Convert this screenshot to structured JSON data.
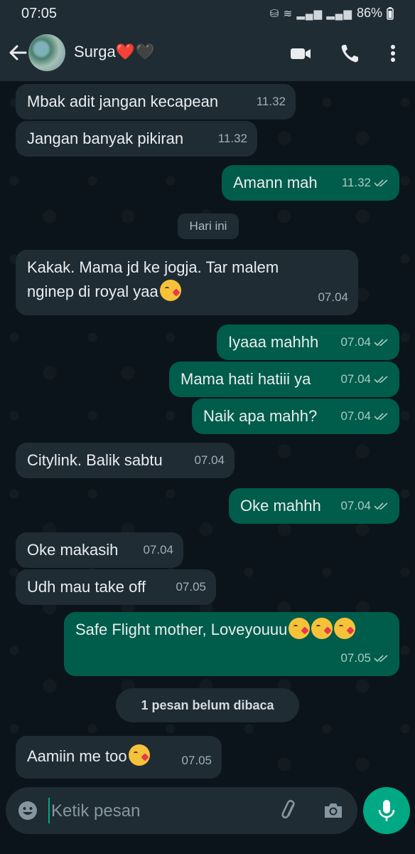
{
  "status_bar": {
    "time": "07:05",
    "battery": "86%"
  },
  "header": {
    "contact_name": "Surga❤️🖤"
  },
  "date_chip": "Hari ini",
  "unread_chip": "1 pesan belum dibaca",
  "messages": [
    {
      "dir": "in",
      "text": "Mbak adit jangan kecapean",
      "time": "11.32"
    },
    {
      "dir": "in",
      "text": "Jangan banyak pikiran",
      "time": "11.32"
    },
    {
      "dir": "out",
      "text": "Amann mah",
      "time": "11.32"
    },
    {
      "dir": "in",
      "text": "Kakak. Mama jd ke jogja. Tar malem",
      "text2": "nginep di royal yaa",
      "time": "07.04"
    },
    {
      "dir": "out",
      "text": "Iyaaa mahhh",
      "time": "07.04"
    },
    {
      "dir": "out",
      "text": "Mama hati hatiii ya",
      "time": "07.04"
    },
    {
      "dir": "out",
      "text": "Naik apa mahh?",
      "time": "07.04"
    },
    {
      "dir": "in",
      "text": "Citylink. Balik sabtu",
      "time": "07.04"
    },
    {
      "dir": "out",
      "text": "Oke mahhh",
      "time": "07.04"
    },
    {
      "dir": "in",
      "text": "Oke makasih",
      "time": "07.04"
    },
    {
      "dir": "in",
      "text": "Udh mau take off",
      "time": "07.05"
    },
    {
      "dir": "out",
      "text": "Safe Flight mother, Loveyouuu",
      "time": "07.05"
    },
    {
      "dir": "in",
      "text": "Aamiin me too",
      "time": "07.05"
    }
  ],
  "composer": {
    "placeholder": "Ketik pesan"
  }
}
